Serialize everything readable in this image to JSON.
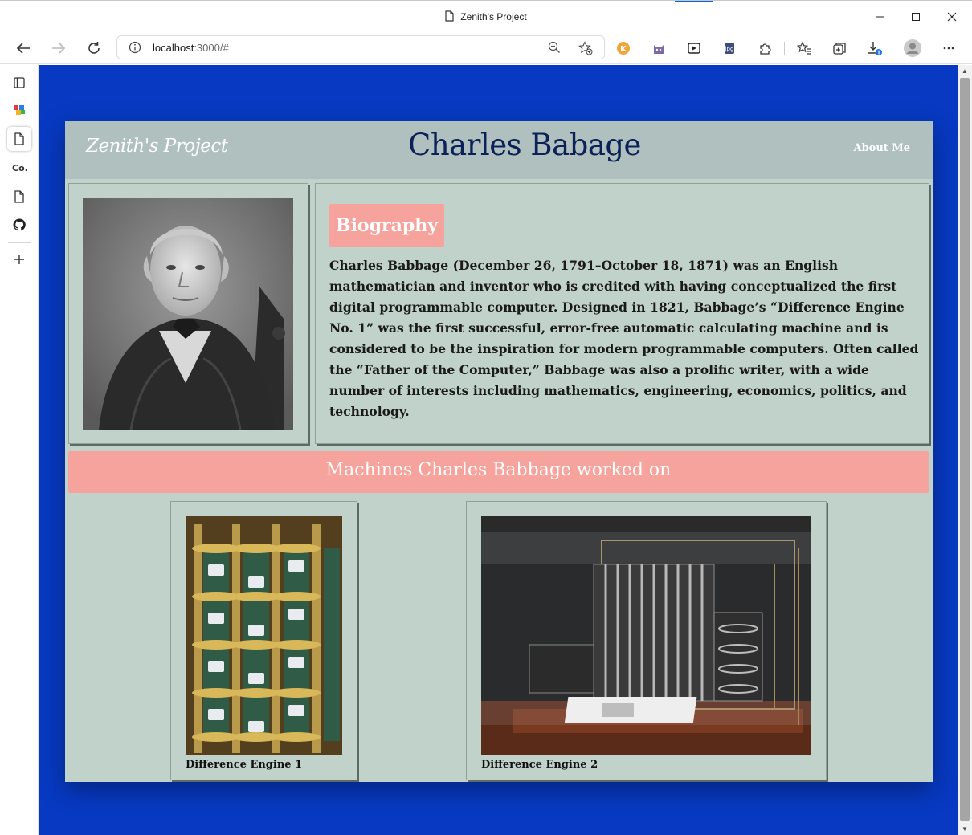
{
  "window": {
    "title": "Zenith's Project"
  },
  "toolbar": {
    "url_host": "localhost",
    "url_rest": ":3000/#"
  },
  "site": {
    "brand": "Zenith's Project",
    "title": "Charles Babage",
    "nav_about": "About Me"
  },
  "bio": {
    "heading": "Biography",
    "text": "Charles Babbage (December 26, 1791–October 18, 1871) was an English mathematician and inventor who is credited with having conceptualized the first digital programmable computer. Designed in 1821, Babbage’s “Difference Engine No. 1” was the first successful, error-free automatic calculating machine and is considered to be the inspiration for modern programmable computers. Often called the “Father of the Computer,” Babbage was also a prolific writer, with a wide number of interests including mathematics, engineering, economics, politics, and technology."
  },
  "machines": {
    "heading": "Machines Charles Babbage worked on",
    "items": [
      {
        "caption": "Difference Engine 1"
      },
      {
        "caption": "Difference Engine 2"
      }
    ]
  },
  "colors": {
    "page_bg": "#0739c2",
    "card_bg": "#c1d2cb",
    "header_bg": "#afc0bf",
    "accent": "#f6a39d",
    "title": "#0b2157"
  }
}
